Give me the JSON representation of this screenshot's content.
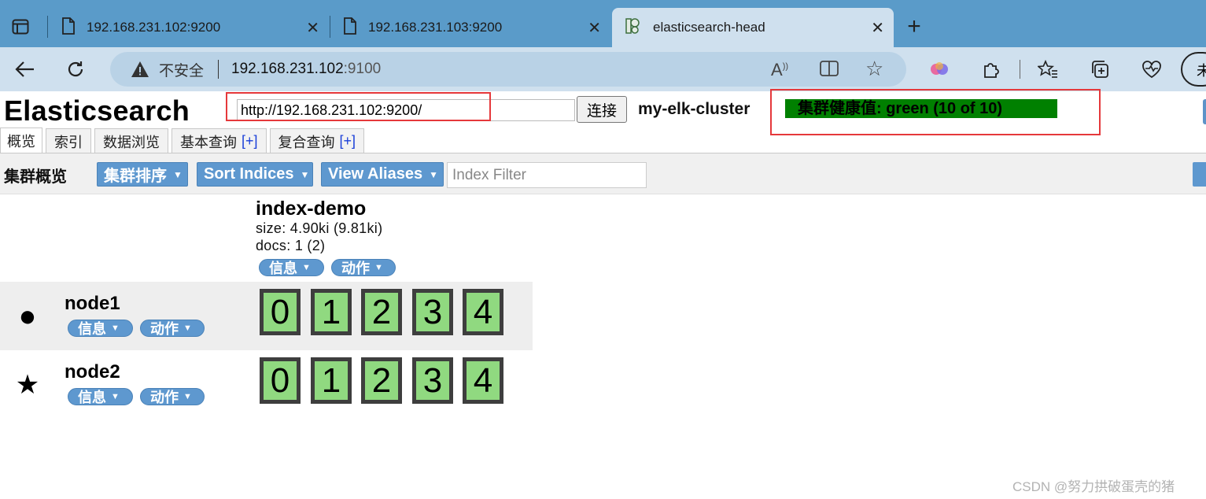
{
  "browser": {
    "tabs": [
      {
        "title": "192.168.231.102:9200",
        "icon": "document-icon",
        "active": false
      },
      {
        "title": "192.168.231.103:9200",
        "icon": "document-icon",
        "active": false
      },
      {
        "title": "elasticsearch-head",
        "icon": "elasticsearch-head-icon",
        "active": true
      }
    ],
    "address": {
      "security_label": "不安全",
      "host": "192.168.231.102",
      "port": ":9100"
    },
    "profile_initial": "未"
  },
  "app": {
    "title": "Elasticsearch",
    "connect_url": "http://192.168.231.102:9200/",
    "connect_label": "连接",
    "cluster_name": "my-elk-cluster",
    "health_text": "集群健康值: green (10 of 10)",
    "health_color": "#008000",
    "tabs": [
      {
        "label": "概览",
        "plus": ""
      },
      {
        "label": "索引",
        "plus": ""
      },
      {
        "label": "数据浏览",
        "plus": ""
      },
      {
        "label": "基本查询",
        "plus": "[+]"
      },
      {
        "label": "复合查询",
        "plus": "[+]"
      }
    ]
  },
  "toolbar": {
    "label": "集群概览",
    "sort_cluster": "集群排序",
    "sort_indices": "Sort Indices",
    "view_aliases": "View Aliases",
    "filter_placeholder": "Index Filter"
  },
  "overview": {
    "index": {
      "name": "index-demo",
      "size": "size: 4.90ki (9.81ki)",
      "docs": "docs: 1 (2)",
      "info_label": "信息",
      "action_label": "动作"
    },
    "nodes": [
      {
        "name": "node1",
        "symbol": "●",
        "symbol_meaning": "master",
        "info_label": "信息",
        "action_label": "动作",
        "shards": [
          "0",
          "1",
          "2",
          "3",
          "4"
        ]
      },
      {
        "name": "node2",
        "symbol": "★",
        "symbol_meaning": "node",
        "info_label": "信息",
        "action_label": "动作",
        "shards": [
          "0",
          "1",
          "2",
          "3",
          "4"
        ]
      }
    ],
    "shard_color": "#90d980"
  },
  "watermark": "CSDN @努力拱破蛋壳的猪"
}
